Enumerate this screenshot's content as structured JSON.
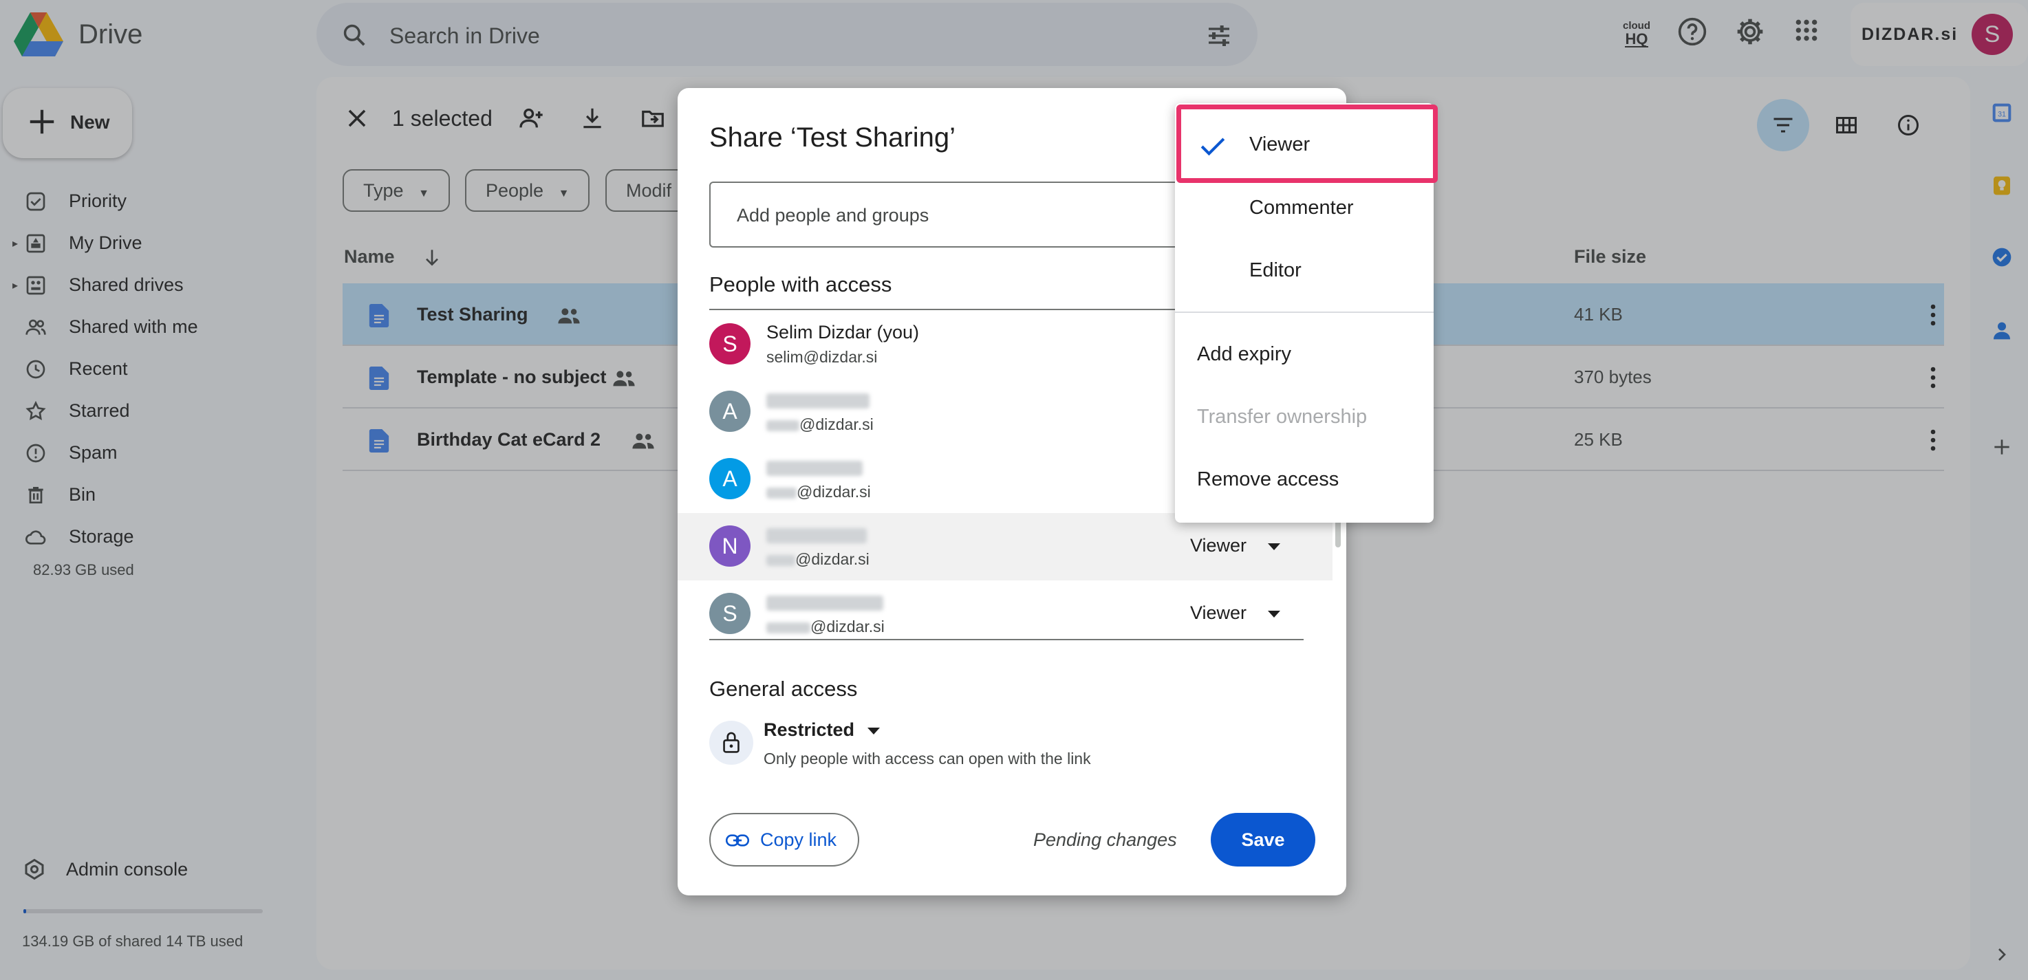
{
  "app": {
    "name": "Drive",
    "search_placeholder": "Search in Drive",
    "cloudhq_label": "cloud HQ",
    "brand": "DIZDAR.si",
    "user_initial": "S"
  },
  "sidebar": {
    "new_label": "New",
    "items": [
      {
        "label": "Priority",
        "icon": "priority-icon"
      },
      {
        "label": "My Drive",
        "icon": "my-drive-icon"
      },
      {
        "label": "Shared drives",
        "icon": "shared-drives-icon"
      },
      {
        "label": "Shared with me",
        "icon": "shared-with-me-icon"
      },
      {
        "label": "Recent",
        "icon": "clock-icon"
      },
      {
        "label": "Starred",
        "icon": "star-icon"
      },
      {
        "label": "Spam",
        "icon": "spam-icon"
      },
      {
        "label": "Bin",
        "icon": "trash-icon"
      },
      {
        "label": "Storage",
        "icon": "cloud-icon"
      }
    ],
    "storage_used": "82.93 GB used",
    "admin_console": "Admin console",
    "quota_fraction": 0.01,
    "quota_text": "134.19 GB of shared 14 TB used"
  },
  "main": {
    "selected_text": "1 selected",
    "chips": [
      "Type",
      "People",
      "Modif"
    ],
    "columns": {
      "name": "Name",
      "file_size": "File size"
    },
    "files": [
      {
        "name": "Test Sharing",
        "size": "41 KB"
      },
      {
        "name": "Template - no subject",
        "size": "370 bytes"
      },
      {
        "name": "Birthday Cat eCard 2",
        "size": "25 KB"
      }
    ]
  },
  "dialog": {
    "title": "Share ‘Test Sharing’",
    "add_placeholder": "Add people and groups",
    "people_with_access": "People with access",
    "people": [
      {
        "initial": "S",
        "color": "#c2185b",
        "name": "Selim Dizdar (you)",
        "email": "selim@dizdar.si",
        "role": ""
      },
      {
        "initial": "A",
        "color": "#78909c",
        "name": "",
        "email": "@dizdar.si",
        "role": ""
      },
      {
        "initial": "A",
        "color": "#039be5",
        "name": "",
        "email": "@dizdar.si",
        "role": ""
      },
      {
        "initial": "N",
        "color": "#7e57c2",
        "name": "",
        "email": "@dizdar.si",
        "role": "Viewer"
      },
      {
        "initial": "S",
        "color": "#78909c",
        "name": "",
        "email": "@dizdar.si",
        "role": "Viewer"
      }
    ],
    "general_access": "General access",
    "access_level": "Restricted",
    "access_desc": "Only people with access can open with the link",
    "copy_link": "Copy link",
    "pending": "Pending changes",
    "save": "Save"
  },
  "menu": {
    "roles": [
      "Viewer",
      "Commenter",
      "Editor"
    ],
    "selected_role": "Viewer",
    "actions": [
      {
        "label": "Add expiry",
        "disabled": false
      },
      {
        "label": "Transfer ownership",
        "disabled": true
      },
      {
        "label": "Remove access",
        "disabled": false
      }
    ]
  },
  "colors": {
    "accent": "#0b57d0",
    "selected_row": "#c2e7ff",
    "highlight": "#e8336b"
  }
}
